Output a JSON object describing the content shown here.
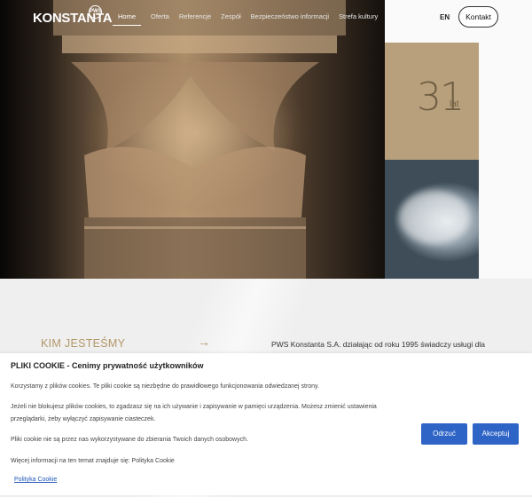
{
  "header": {
    "logo_text": "KONSTANTA",
    "logo_badge": "PWS",
    "nav": [
      "Home",
      "Oferta",
      "Referencje",
      "Zespół",
      "Bezpieczeństwo informacji",
      "Strefa kultury"
    ],
    "lang": "EN",
    "contact_label": "Kontakt"
  },
  "hero": {
    "years_number": "31",
    "years_unit": "lat"
  },
  "about": {
    "heading": "KIM JESTEŚMY",
    "arrow": "→",
    "text": "PWS Konstanta S.A. działając od roku 1995 świadczy usługi dla"
  },
  "cookie": {
    "title": "PLIKI COOKIE - Cenimy prywatność użytkowników",
    "line1": "Korzystamy z plików cookies. Te pliki cookie są niezbędne do prawidłowego funkcjonowania odwiedzanej strony.",
    "line2": "Jeżeli nie blokujesz plików cookies, to zgadzasz się na ich używanie i zapisywanie w pamięci urządzenia. Możesz zmienić ustawienia",
    "line3": "przeglądarki, żeby wyłączyć zapisywanie ciasteczek.",
    "line4": "Pliki cookie nie są przez nas wykorzystywane do zbierania Twoich danych osobowych.",
    "line5": "Więcej informacji na ten temat znajduje się: Polityka Cookie",
    "policy_link": "Polityka Cookie",
    "reject_label": "Odrzuć",
    "accept_label": "Akceptuj"
  },
  "colors": {
    "accent_gold": "#b8a07c",
    "button_blue": "#2e64c6"
  }
}
